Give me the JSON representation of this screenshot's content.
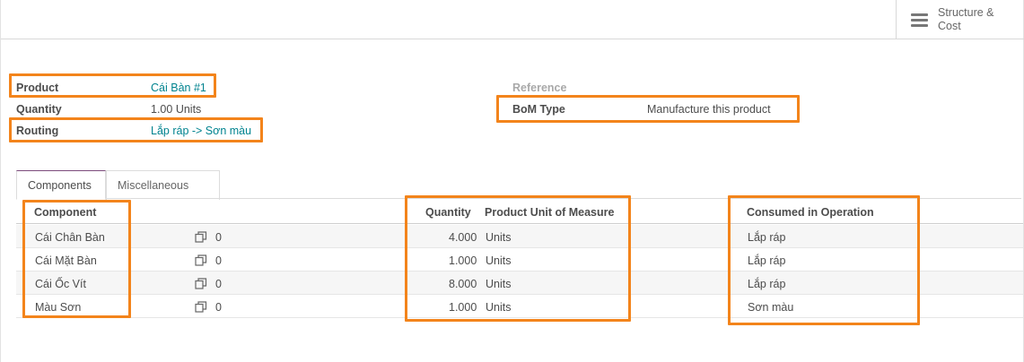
{
  "header": {
    "structure_button": "Structure &\nCost"
  },
  "form": {
    "product": {
      "label": "Product",
      "value": "Cái Bàn #1"
    },
    "quantity": {
      "label": "Quantity",
      "value": "1.00",
      "unit": "Units"
    },
    "routing": {
      "label": "Routing",
      "value": "Lắp ráp -> Sơn màu"
    },
    "reference": {
      "label": "Reference",
      "value": ""
    },
    "bom_type": {
      "label": "BoM Type",
      "value": "Manufacture this product"
    }
  },
  "tabs": [
    {
      "label": "Components",
      "active": true
    },
    {
      "label": "Miscellaneous",
      "active": false
    }
  ],
  "table": {
    "columns": {
      "component": "Component",
      "quantity": "Quantity",
      "uom": "Product Unit of Measure",
      "operation": "Consumed in Operation"
    },
    "rows": [
      {
        "component": "Cái Chân Bàn",
        "attachments": "0",
        "quantity": "4.000",
        "uom": "Units",
        "operation": "Lắp ráp"
      },
      {
        "component": "Cái Mặt Bàn",
        "attachments": "0",
        "quantity": "1.000",
        "uom": "Units",
        "operation": "Lắp ráp"
      },
      {
        "component": "Cái Ốc Vít",
        "attachments": "0",
        "quantity": "8.000",
        "uom": "Units",
        "operation": "Lắp ráp"
      },
      {
        "component": "Màu Sơn",
        "attachments": "0",
        "quantity": "1.000",
        "uom": "Units",
        "operation": "Sơn màu"
      }
    ]
  },
  "colors": {
    "highlight": "#f3841b",
    "link": "#00838f",
    "tab_accent": "#7c4b7c"
  }
}
